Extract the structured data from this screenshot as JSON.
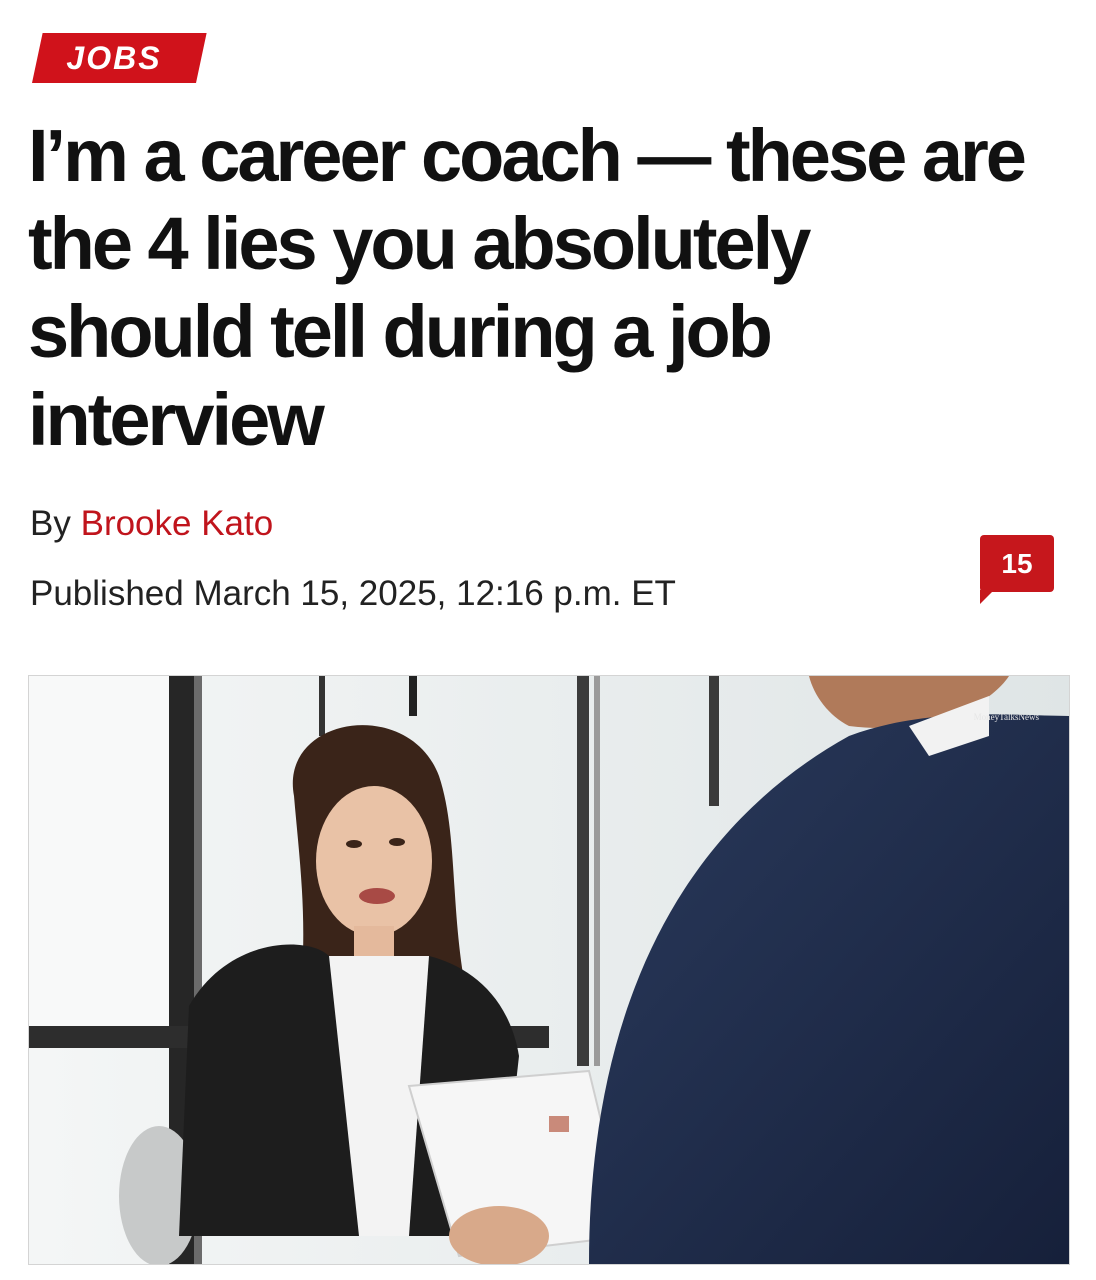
{
  "section": {
    "label": "JOBS"
  },
  "article": {
    "headline": "I’m a career coach — these are the 4 lies you absolutely should tell during a job interview",
    "byline_prefix": "By",
    "author": "Brooke Kato",
    "published": "Published March 15, 2025, 12:16 p.m. ET"
  },
  "comments": {
    "count": "15"
  },
  "image": {
    "watermark": "MoneyTalksNews"
  },
  "colors": {
    "accent": "#d0121b",
    "author_link": "#c0141c",
    "text": "#111111"
  }
}
